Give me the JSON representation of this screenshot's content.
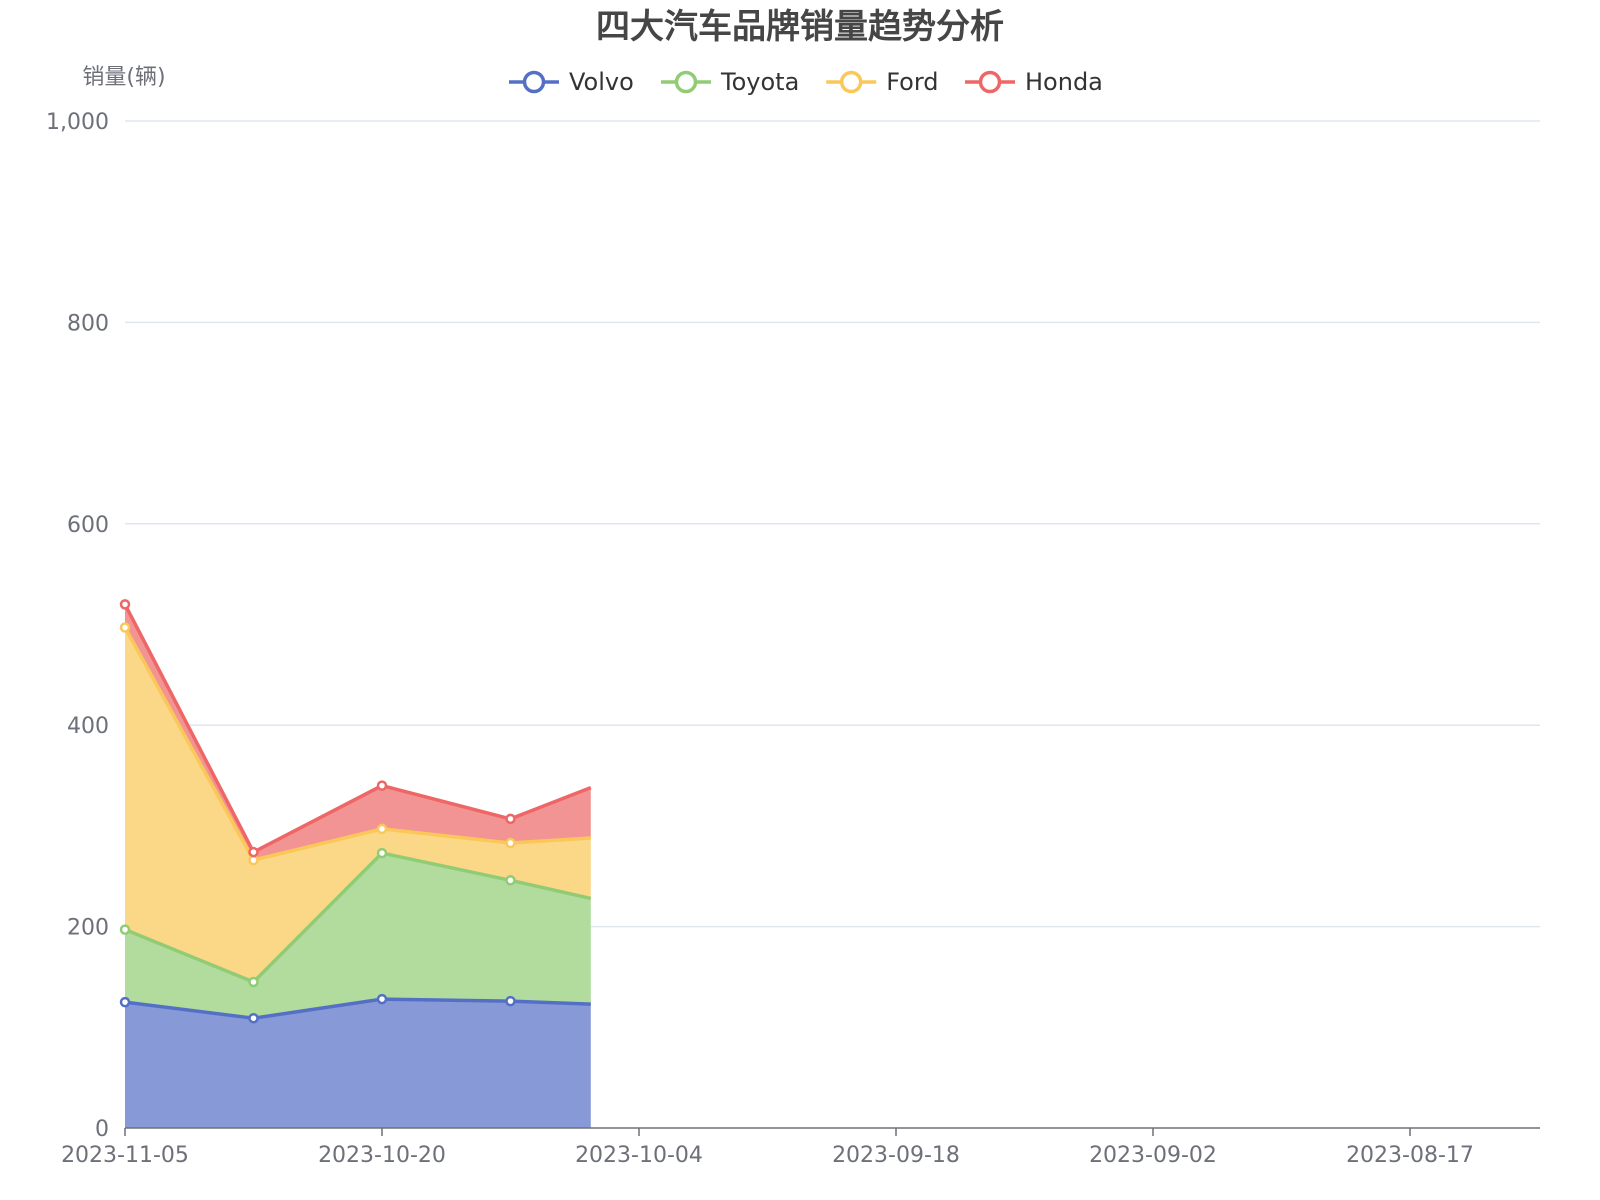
{
  "chart_data": {
    "type": "area",
    "stacked": true,
    "title": "四大汽车品牌销量趋势分析",
    "ylabel": "销量(辆)",
    "xlabel": "",
    "ylim": [
      0,
      1000
    ],
    "y_ticks": [
      "0",
      "200",
      "400",
      "600",
      "800",
      "1,000"
    ],
    "x_ticks": [
      "2023-11-05",
      "2023-10-20",
      "2023-10-04",
      "2023-09-18",
      "2023-09-02",
      "2023-08-17"
    ],
    "x_axis_direction": "descending dates",
    "grid": true,
    "legend_position": "top-center",
    "x": [
      "2023-11-05",
      "2023-10-28",
      "2023-10-20",
      "2023-10-12",
      "2023-10-07"
    ],
    "series": [
      {
        "name": "Volvo",
        "color": "#5470c6",
        "area_color": "#8799d6",
        "values": [
          125,
          109,
          128,
          126,
          123
        ]
      },
      {
        "name": "Toyota",
        "color": "#91cc75",
        "area_color": "#b1dc9e",
        "values": [
          72,
          36,
          145,
          120,
          105
        ]
      },
      {
        "name": "Ford",
        "color": "#fac858",
        "area_color": "#fbd788",
        "values": [
          300,
          121,
          24,
          37,
          60
        ]
      },
      {
        "name": "Honda",
        "color": "#ee6666",
        "area_color": "#f39494",
        "values": [
          23,
          8,
          43,
          24,
          50
        ]
      }
    ]
  }
}
